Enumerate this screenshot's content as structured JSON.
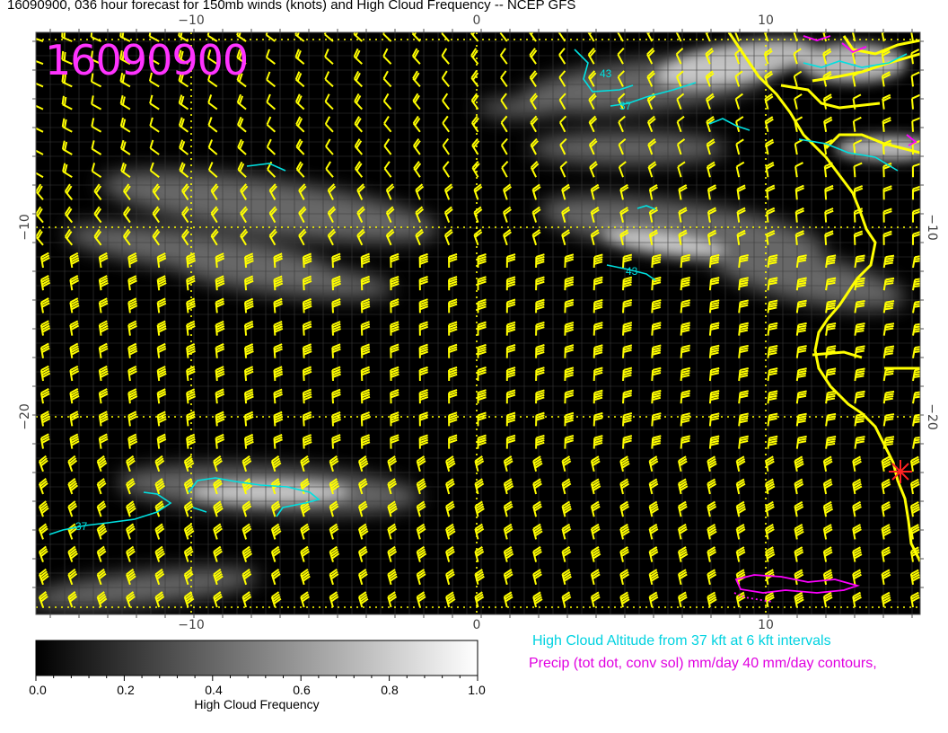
{
  "title": "16090900, 036 hour forecast for 150mb winds (knots) and High Cloud Frequency -- NCEP GFS",
  "stamp": "16090900",
  "axes": {
    "top_ticks": [
      "−10",
      "0",
      "10"
    ],
    "bottom_ticks": [
      "−10",
      "0",
      "10"
    ],
    "left_ticks": [
      "−10",
      "−20"
    ],
    "right_ticks": [
      "−10",
      "−20"
    ]
  },
  "contour_labels": [
    "43",
    "37",
    "37",
    "43",
    "37"
  ],
  "colorbar": {
    "title": "High Cloud Frequency",
    "ticks": [
      "0.0",
      "0.2",
      "0.4",
      "0.6",
      "0.8",
      "1.0"
    ]
  },
  "legend": {
    "cloud_altitude": "High Cloud Altitude from 37 kft at 6 kft intervals",
    "precip": "Precip (tot dot, conv sol) mm/day 40 mm/day contours,"
  },
  "colors": {
    "map_bg": "#000000",
    "barbs": "#ffff00",
    "coast": "#ffff00",
    "cloud_contour": "#00e0e0",
    "precip_contour": "#ff00ff",
    "marker": "#ff2222"
  }
}
